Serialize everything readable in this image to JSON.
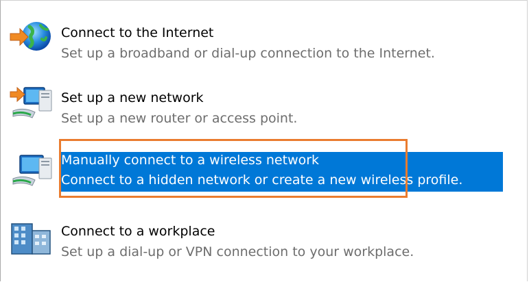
{
  "options": [
    {
      "title": "Connect to the Internet",
      "description": "Set up a broadband or dial-up connection to the Internet.",
      "icon": "globe-arrow-icon"
    },
    {
      "title": "Set up a new network",
      "description": "Set up a new router or access point.",
      "icon": "new-network-icon"
    },
    {
      "title": "Manually connect to a wireless network",
      "description": "Connect to a hidden network or create a new wireless profile.",
      "icon": "wireless-network-icon",
      "selected": true
    },
    {
      "title": "Connect to a workplace",
      "description": "Set up a dial-up or VPN connection to your workplace.",
      "icon": "workplace-building-icon"
    }
  ],
  "colors": {
    "selection": "#0078d7",
    "focus_outline": "#ea7c2f",
    "description_text": "#6d6d6d"
  }
}
